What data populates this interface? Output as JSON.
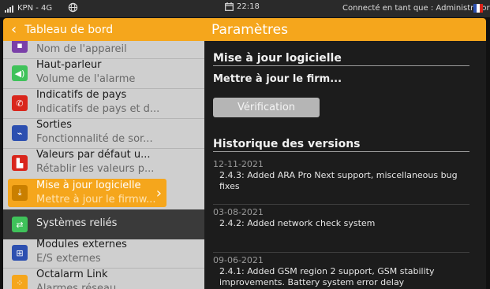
{
  "status_bar": {
    "carrier": "KPN - 4G",
    "time": "22:18",
    "user": "Connecté en tant que : Administrator"
  },
  "header": {
    "back_label": "Tableau de bord",
    "title": "Paramètres"
  },
  "sidebar": {
    "items": [
      {
        "label": "",
        "sublabel": "Nom de l'appareil",
        "icon": "device-icon",
        "color": "#7a3fa8"
      },
      {
        "label": "Haut-parleur",
        "sublabel": "Volume de l'alarme",
        "icon": "speaker-icon",
        "color": "#3fc25a"
      },
      {
        "label": "Indicatifs de pays",
        "sublabel": "Indicatifs de pays et d...",
        "icon": "phone-icon",
        "color": "#d9261c"
      },
      {
        "label": "Sorties",
        "sublabel": "Fonctionnalité de sor...",
        "icon": "outputs-icon",
        "color": "#2c4fb0"
      },
      {
        "label": "Valeurs par défaut u...",
        "sublabel": "Rétablir les valeurs p...",
        "icon": "factory-icon",
        "color": "#d9261c"
      },
      {
        "label": "Mise à jour logicielle",
        "sublabel": "Mettre à jour le firmw...",
        "icon": "download-icon",
        "color": "#f5a61c"
      },
      {
        "label": "Systèmes reliés",
        "sublabel": "",
        "icon": "linked-systems-icon",
        "color": "#3fc25a"
      },
      {
        "label": "Modules externes",
        "sublabel": "E/S externes",
        "icon": "modules-icon",
        "color": "#2c4fb0"
      },
      {
        "label": "Octalarm Link",
        "sublabel": "Alarmes réseau",
        "icon": "network-icon",
        "color": "#f5a61c"
      }
    ]
  },
  "content": {
    "software_update_title": "Mise à jour logicielle",
    "firmware_label": "Mettre à jour le firm...",
    "verify_button": "Vérification",
    "history_title": "Historique des versions",
    "versions": [
      {
        "date": "12-11-2021",
        "desc": "2.4.3: Added ARA Pro Next support, miscellaneous bug fixes"
      },
      {
        "date": "03-08-2021",
        "desc": "2.4.2: Added network check system"
      },
      {
        "date": "09-06-2021",
        "desc": "2.4.1: Added GSM region 2 support, GSM stability improvements. Battery system error delay"
      }
    ]
  },
  "colors": {
    "accent": "#f5a61c",
    "sidebar_bg": "#cfcfcf",
    "content_bg": "#1c1c1c"
  }
}
